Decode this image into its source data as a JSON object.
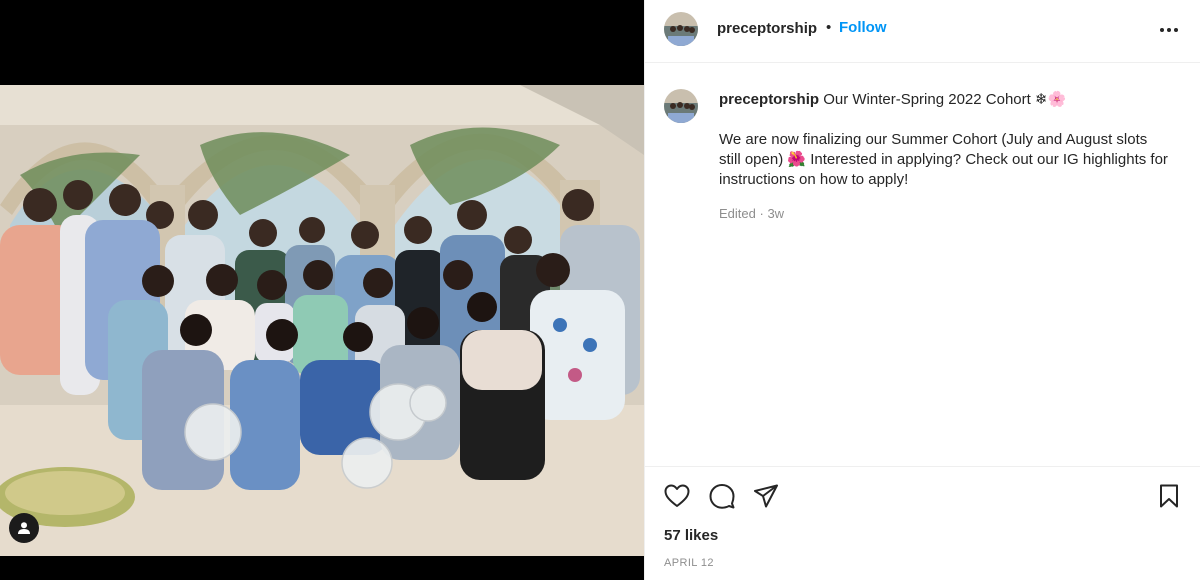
{
  "post": {
    "username": "preceptorship",
    "follow_label": "Follow",
    "separator": "•",
    "caption": {
      "title": "Our Winter-Spring 2022 Cohort ❄🌸",
      "body": "We are now finalizing our Summer Cohort (July and August slots still open) 🌺 Interested in applying? Check out our IG highlights for instructions on how to apply!",
      "edited_label": "Edited",
      "meta_separator": " · ",
      "time_ago": "3w"
    },
    "likes": "57 likes",
    "date": "APRIL 12"
  },
  "colors": {
    "link_blue": "#0095f6",
    "muted_text": "#8e8e8e",
    "border": "#efefef",
    "text": "#262626"
  },
  "icons": {
    "more": "more-horizontal-icon",
    "like": "heart-icon",
    "comment": "comment-bubble-icon",
    "share": "paper-plane-icon",
    "save": "bookmark-icon",
    "tag": "user-tag-icon"
  }
}
